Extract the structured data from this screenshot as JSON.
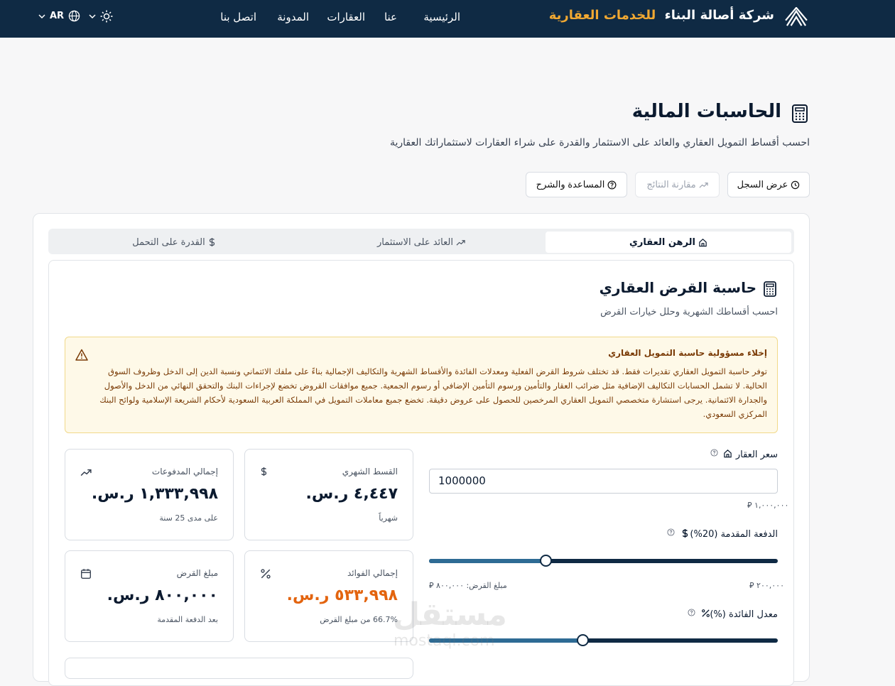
{
  "header": {
    "brand_name": "شركة أصالة البناء",
    "brand_accent": "للخدمات العقارية",
    "brand_color": "#0f2a44",
    "accent_color": "#f0a832",
    "nav": [
      "الرئيسية",
      "عنا",
      "العقارات",
      "المدونة",
      "اتصل بنا"
    ],
    "language": "AR",
    "icons": [
      "logo-icon",
      "theme-sun-icon",
      "globe-icon",
      "chevron-down-icon"
    ]
  },
  "page": {
    "title": "الحاسبات المالية",
    "subtitle": "احسب أقساط التمويل العقاري والعائد على الاستثمار والقدرة على شراء العقارات لاستثماراتك العقارية",
    "actions": {
      "history": "عرض السجل",
      "compare": "مقارنة النتائج",
      "help": "المساعدة والشرح"
    }
  },
  "tabs": {
    "mortgage": "الرهن العقاري",
    "roi": "العائد على الاستثمار",
    "affordability": "القدرة على التحمل"
  },
  "calculator": {
    "title": "حاسبة القرض العقاري",
    "subtitle": "احسب أقساطك الشهرية وحلل خيارات القرض"
  },
  "disclaimer": {
    "title": "إخلاء مسؤولية حاسبة التمويل العقاري",
    "body": "توفر حاسبة التمويل العقاري تقديرات فقط. قد تختلف شروط القرض الفعلية ومعدلات الفائدة والأقساط الشهرية والتكاليف الإجمالية بناءً على ملفك الائتماني ونسبة الدين إلى الدخل وظروف السوق الحالية. لا تشمل الحسابات التكاليف الإضافية مثل ضرائب العقار والتأمين ورسوم التأمين الإضافي أو رسوم الجمعية. جميع موافقات القروض تخضع لإجراءات البنك والتحقق النهائي من الدخل والأصول والجدارة الائتمانية. يرجى استشارة متخصصي التمويل العقاري المرخصين للحصول على عروض دقيقة. تخضع جميع معاملات التمويل في المملكة العربية السعودية لأحكام الشريعة الإسلامية ولوائح البنك المركزي السعودي."
  },
  "stats": {
    "monthly": {
      "label": "القسط الشهري",
      "value": "٤,٤٤٧ ر.س.",
      "note": "شهرياً"
    },
    "total_payments": {
      "label": "إجمالي المدفوعات",
      "value": "١,٣٣٣,٩٩٨ ر.س.",
      "note": "على مدى 25 سنة"
    },
    "total_interest": {
      "label": "إجمالي الفوائد",
      "value": "٥٣٣,٩٩٨ ر.س.",
      "note": "66.7% من مبلغ القرض",
      "color": "#e3640f"
    },
    "loan_amount": {
      "label": "مبلغ القرض",
      "value": "٨٠٠,٠٠٠ ر.س.",
      "note": "بعد الدفعة المقدمة"
    }
  },
  "inputs": {
    "price": {
      "label": "سعر العقار",
      "value": "1000000",
      "formatted": "١,٠٠٠,٠٠٠"
    },
    "down_payment": {
      "label": "الدفعة المقدمة (20%)",
      "amount": "٢٠٠,٠٠٠",
      "loan_note": "مبلغ القرض: ٨٠٠,٠٠٠",
      "percent": 20
    },
    "interest": {
      "label": "معدل الفائدة (%)",
      "level": 0.44
    }
  },
  "watermark": {
    "text": "مستقل",
    "url": "mostaql.com"
  }
}
